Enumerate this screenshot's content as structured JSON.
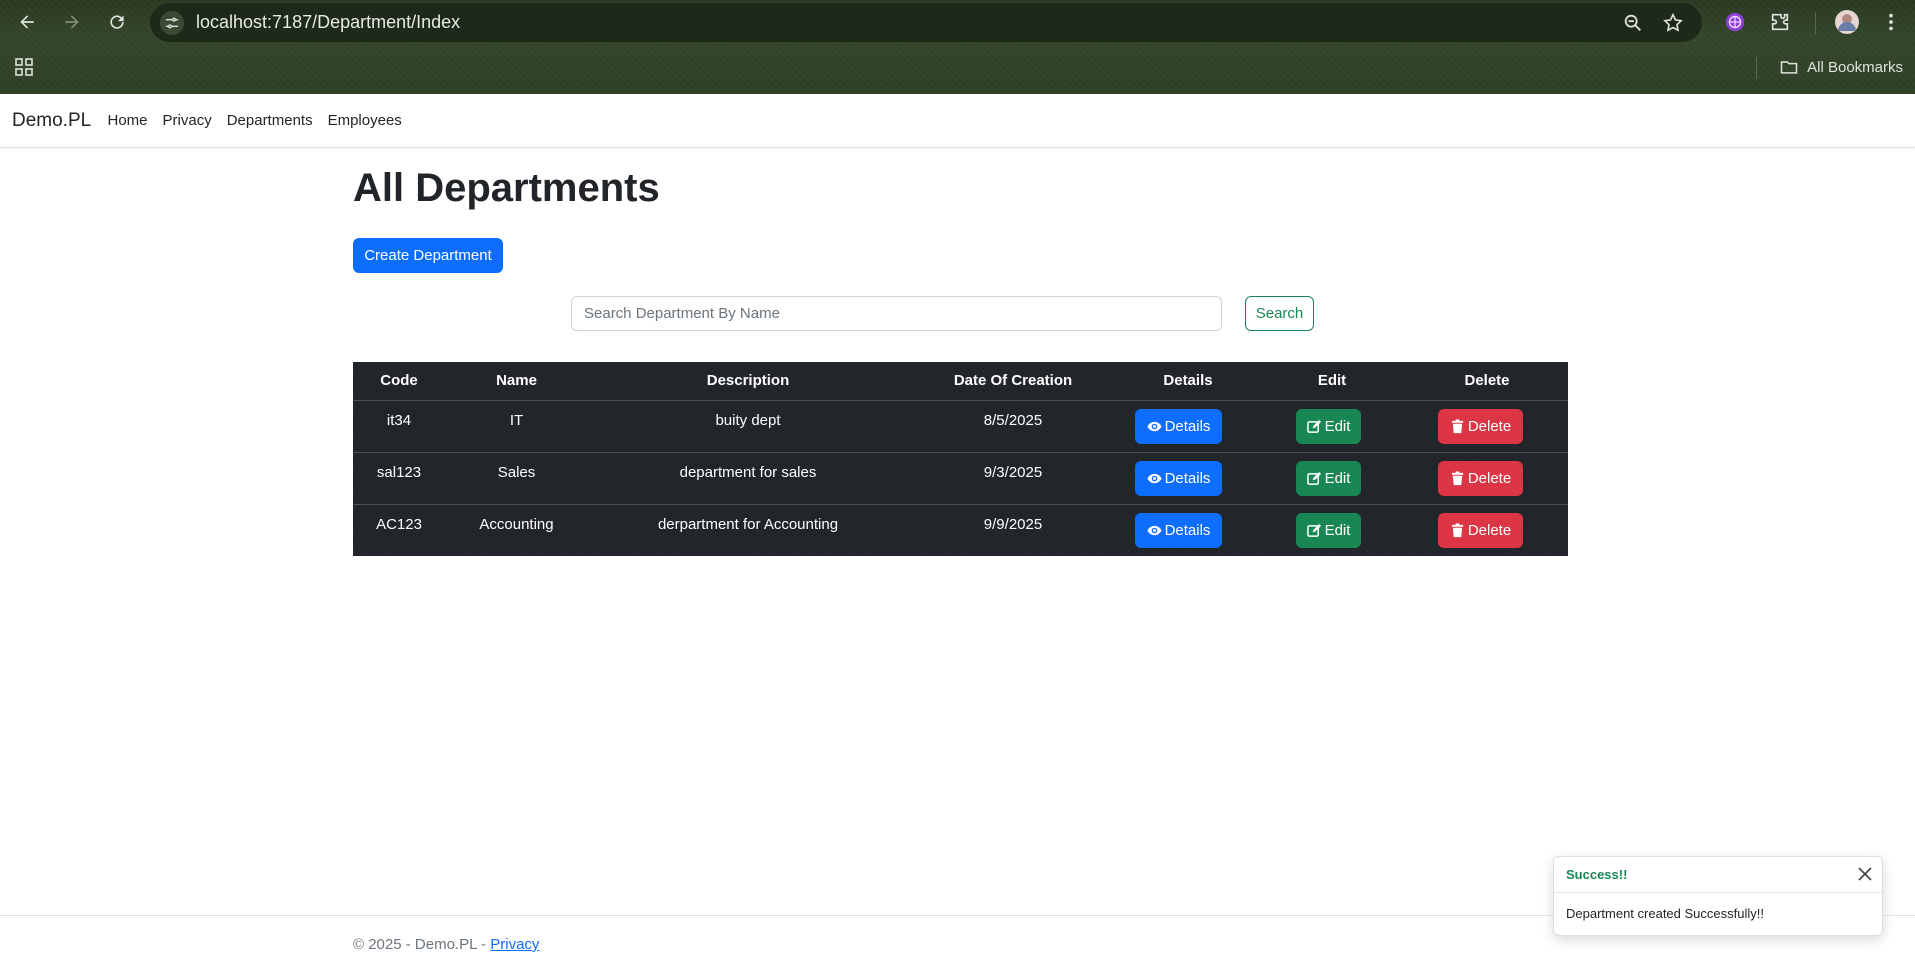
{
  "browser": {
    "url": "localhost:7187/Department/Index",
    "bookmarks_label": "All Bookmarks"
  },
  "navbar": {
    "brand": "Demo.PL",
    "links": [
      "Home",
      "Privacy",
      "Departments",
      "Employees"
    ]
  },
  "page": {
    "title": "All Departments",
    "create_button": "Create Department",
    "search": {
      "placeholder": "Search Department By Name",
      "value": "",
      "button": "Search"
    }
  },
  "table": {
    "headers": [
      "Code",
      "Name",
      "Description",
      "Date Of Creation",
      "Details",
      "Edit",
      "Delete"
    ],
    "rows": [
      {
        "code": "it34",
        "name": "IT",
        "description": "buity dept",
        "date": "8/5/2025"
      },
      {
        "code": "sal123",
        "name": "Sales",
        "description": "department for sales",
        "date": "9/3/2025"
      },
      {
        "code": "AC123",
        "name": "Accounting",
        "description": "derpartment for Accounting",
        "date": "9/9/2025"
      }
    ],
    "action_labels": {
      "details": "Details",
      "edit": "Edit",
      "delete": "Delete"
    }
  },
  "footer": {
    "text": "© 2025 - Demo.PL - ",
    "link": "Privacy"
  },
  "toast": {
    "title": "Success!!",
    "message": "Department created Successfully!!"
  },
  "colors": {
    "primary": "#0d6efd",
    "success": "#198754",
    "danger": "#dc3545",
    "table_dark": "#212529",
    "chrome": "#2e3f27"
  }
}
